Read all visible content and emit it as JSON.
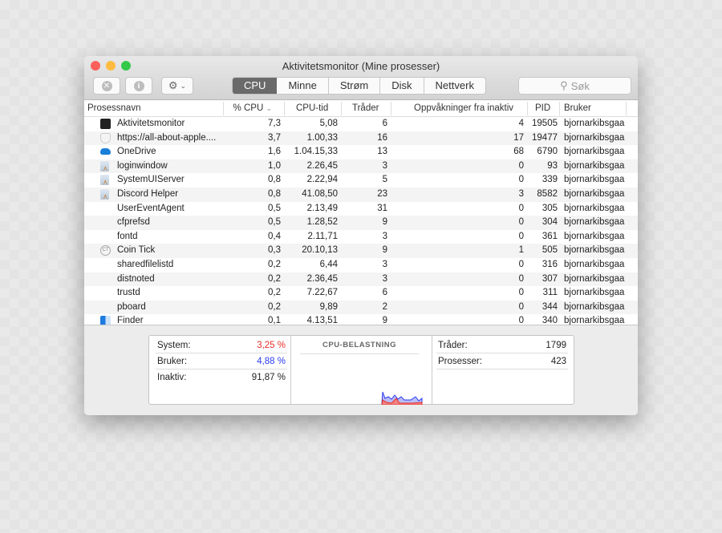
{
  "window": {
    "title": "Aktivitetsmonitor (Mine prosesser)"
  },
  "toolbar": {
    "tabs": [
      "CPU",
      "Minne",
      "Strøm",
      "Disk",
      "Nettverk"
    ],
    "active_tab": "CPU",
    "search_placeholder": "Søk",
    "close_icon": "x-circle-icon",
    "info_icon": "info-icon",
    "gear_icon": "gear-icon"
  },
  "table": {
    "columns": [
      "Prosessnavn",
      "% CPU",
      "CPU-tid",
      "Tråder",
      "Oppvåkninger fra inaktiv",
      "PID",
      "Bruker"
    ],
    "sort_column": "% CPU",
    "rows": [
      {
        "name": "Aktivitetsmonitor",
        "icon": "activity-monitor",
        "cpu": "7,3",
        "time": "5,08",
        "threads": "6",
        "wakeups": "4",
        "pid": "19505",
        "user": "bjornarkibsgaa"
      },
      {
        "name": "https://all-about-apple....",
        "icon": "shield",
        "cpu": "3,7",
        "time": "1.00,33",
        "threads": "16",
        "wakeups": "17",
        "pid": "19477",
        "user": "bjornarkibsgaa"
      },
      {
        "name": "OneDrive",
        "icon": "cloud",
        "cpu": "1,6",
        "time": "1.04.15,33",
        "threads": "13",
        "wakeups": "68",
        "pid": "6790",
        "user": "bjornarkibsgaa"
      },
      {
        "name": "loginwindow",
        "icon": "app",
        "cpu": "1,0",
        "time": "2.26,45",
        "threads": "3",
        "wakeups": "0",
        "pid": "93",
        "user": "bjornarkibsgaa"
      },
      {
        "name": "SystemUIServer",
        "icon": "app",
        "cpu": "0,8",
        "time": "2.22,94",
        "threads": "5",
        "wakeups": "0",
        "pid": "339",
        "user": "bjornarkibsgaa"
      },
      {
        "name": "Discord Helper",
        "icon": "app",
        "cpu": "0,8",
        "time": "41.08,50",
        "threads": "23",
        "wakeups": "3",
        "pid": "8582",
        "user": "bjornarkibsgaa"
      },
      {
        "name": "UserEventAgent",
        "icon": "",
        "cpu": "0,5",
        "time": "2.13,49",
        "threads": "31",
        "wakeups": "0",
        "pid": "305",
        "user": "bjornarkibsgaa"
      },
      {
        "name": "cfprefsd",
        "icon": "",
        "cpu": "0,5",
        "time": "1.28,52",
        "threads": "9",
        "wakeups": "0",
        "pid": "304",
        "user": "bjornarkibsgaa"
      },
      {
        "name": "fontd",
        "icon": "",
        "cpu": "0,4",
        "time": "2.11,71",
        "threads": "3",
        "wakeups": "0",
        "pid": "361",
        "user": "bjornarkibsgaa"
      },
      {
        "name": "Coin Tick",
        "icon": "coin",
        "cpu": "0,3",
        "time": "20.10,13",
        "threads": "9",
        "wakeups": "1",
        "pid": "505",
        "user": "bjornarkibsgaa"
      },
      {
        "name": "sharedfilelistd",
        "icon": "",
        "cpu": "0,2",
        "time": "6,44",
        "threads": "3",
        "wakeups": "0",
        "pid": "316",
        "user": "bjornarkibsgaa"
      },
      {
        "name": "distnoted",
        "icon": "",
        "cpu": "0,2",
        "time": "2.36,45",
        "threads": "3",
        "wakeups": "0",
        "pid": "307",
        "user": "bjornarkibsgaa"
      },
      {
        "name": "trustd",
        "icon": "",
        "cpu": "0,2",
        "time": "7.22,67",
        "threads": "6",
        "wakeups": "0",
        "pid": "311",
        "user": "bjornarkibsgaa"
      },
      {
        "name": "pboard",
        "icon": "",
        "cpu": "0,2",
        "time": "9,89",
        "threads": "2",
        "wakeups": "0",
        "pid": "344",
        "user": "bjornarkibsgaa"
      },
      {
        "name": "Finder",
        "icon": "finder",
        "cpu": "0,1",
        "time": "4.13,51",
        "threads": "9",
        "wakeups": "0",
        "pid": "340",
        "user": "bjornarkibsgaa"
      }
    ]
  },
  "summary": {
    "system_label": "System:",
    "system_value": "3,25 %",
    "system_color": "#e8302a",
    "user_label": "Bruker:",
    "user_value": "4,88 %",
    "user_color": "#2b3bf0",
    "idle_label": "Inaktiv:",
    "idle_value": "91,87 %",
    "graph_title": "CPU-BELASTNING",
    "threads_label": "Tråder:",
    "threads_value": "1799",
    "processes_label": "Prosesser:",
    "processes_value": "423"
  }
}
